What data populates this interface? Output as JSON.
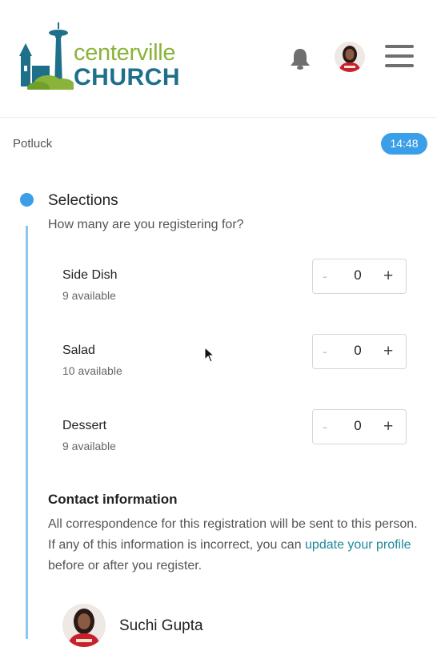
{
  "brand": {
    "name_top": "centerville",
    "name_bottom": "CHURCH"
  },
  "header": {
    "notifications_icon": "bell-icon",
    "profile_icon": "avatar",
    "menu_icon": "hamburger-icon"
  },
  "event": {
    "title": "Potluck",
    "timer": "14:48"
  },
  "selections": {
    "title": "Selections",
    "subtitle": "How many are you registering for?",
    "items": [
      {
        "name": "Side Dish",
        "availability": "9 available",
        "quantity": "0",
        "minus": "-",
        "plus": "+"
      },
      {
        "name": "Salad",
        "availability": "10 available",
        "quantity": "0",
        "minus": "-",
        "plus": "+"
      },
      {
        "name": "Dessert",
        "availability": "9 available",
        "quantity": "0",
        "minus": "-",
        "plus": "+"
      }
    ]
  },
  "contact": {
    "title": "Contact information",
    "text_before": "All correspondence for this registration will be sent to this person. If any of this information is incorrect, you can ",
    "link_text": "update your profile",
    "text_after": " before or after you register.",
    "person_name": "Suchi Gupta"
  },
  "colors": {
    "accent": "#3b9ee8",
    "brand_green": "#8ab339",
    "brand_blue": "#1e6f8a",
    "link": "#1f8a9a"
  }
}
